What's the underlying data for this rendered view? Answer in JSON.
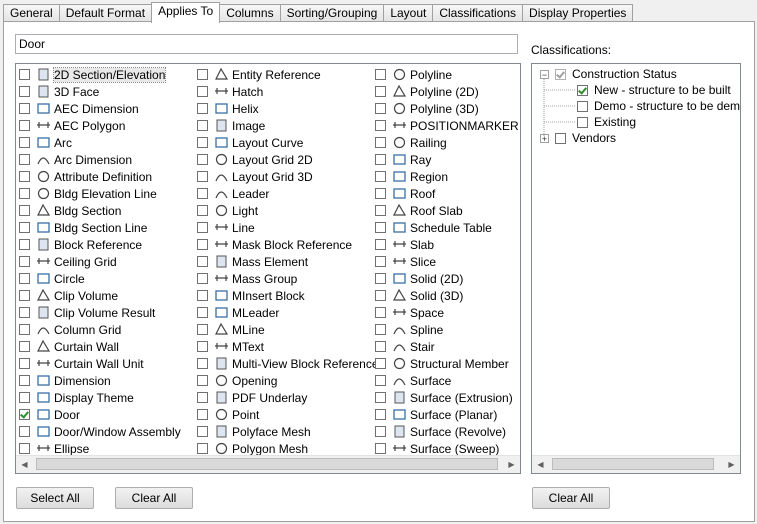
{
  "tabs": [
    "General",
    "Default Format",
    "Applies To",
    "Columns",
    "Sorting/Grouping",
    "Layout",
    "Classifications",
    "Display Properties"
  ],
  "active_tab": "Applies To",
  "filter_value": "Door",
  "col1": [
    {
      "label": "2D Section/Elevation",
      "icon": "section-elevation-icon",
      "checked": false,
      "focused": true
    },
    {
      "label": "3D Face",
      "icon": "3d-face-icon",
      "checked": false
    },
    {
      "label": "AEC Dimension",
      "icon": "aec-dimension-icon",
      "checked": false
    },
    {
      "label": "AEC Polygon",
      "icon": "aec-polygon-icon",
      "checked": false
    },
    {
      "label": "Arc",
      "icon": "arc-icon",
      "checked": false
    },
    {
      "label": "Arc Dimension",
      "icon": "arc-dimension-icon",
      "checked": false
    },
    {
      "label": "Attribute Definition",
      "icon": "attribute-definition-icon",
      "checked": false
    },
    {
      "label": "Bldg Elevation Line",
      "icon": "bldg-elevation-line-icon",
      "checked": false
    },
    {
      "label": "Bldg Section",
      "icon": "bldg-section-icon",
      "checked": false
    },
    {
      "label": "Bldg Section Line",
      "icon": "bldg-section-line-icon",
      "checked": false
    },
    {
      "label": "Block Reference",
      "icon": "block-reference-icon",
      "checked": false
    },
    {
      "label": "Ceiling Grid",
      "icon": "ceiling-grid-icon",
      "checked": false
    },
    {
      "label": "Circle",
      "icon": "circle-icon",
      "checked": false
    },
    {
      "label": "Clip Volume",
      "icon": "clip-volume-icon",
      "checked": false
    },
    {
      "label": "Clip Volume Result",
      "icon": "clip-volume-result-icon",
      "checked": false
    },
    {
      "label": "Column Grid",
      "icon": "column-grid-icon",
      "checked": false
    },
    {
      "label": "Curtain Wall",
      "icon": "curtain-wall-icon",
      "checked": false
    },
    {
      "label": "Curtain Wall Unit",
      "icon": "curtain-wall-unit-icon",
      "checked": false
    },
    {
      "label": "Dimension",
      "icon": "dimension-icon",
      "checked": false
    },
    {
      "label": "Display Theme",
      "icon": "display-theme-icon",
      "checked": false
    },
    {
      "label": "Door",
      "icon": "door-icon",
      "checked": true
    },
    {
      "label": "Door/Window Assembly",
      "icon": "door-window-assembly-icon",
      "checked": false
    },
    {
      "label": "Ellipse",
      "icon": "ellipse-icon",
      "checked": false
    }
  ],
  "col2": [
    {
      "label": "Entity Reference",
      "icon": "entity-reference-icon",
      "checked": false
    },
    {
      "label": "Hatch",
      "icon": "hatch-icon",
      "checked": false
    },
    {
      "label": "Helix",
      "icon": "helix-icon",
      "checked": false
    },
    {
      "label": "Image",
      "icon": "image-icon",
      "checked": false
    },
    {
      "label": "Layout Curve",
      "icon": "layout-curve-icon",
      "checked": false
    },
    {
      "label": "Layout Grid 2D",
      "icon": "layout-grid-2d-icon",
      "checked": false
    },
    {
      "label": "Layout Grid 3D",
      "icon": "layout-grid-3d-icon",
      "checked": false
    },
    {
      "label": "Leader",
      "icon": "leader-icon",
      "checked": false
    },
    {
      "label": "Light",
      "icon": "light-icon",
      "checked": false
    },
    {
      "label": "Line",
      "icon": "line-icon",
      "checked": false
    },
    {
      "label": "Mask Block Reference",
      "icon": "mask-block-icon",
      "checked": false
    },
    {
      "label": "Mass Element",
      "icon": "mass-element-icon",
      "checked": false
    },
    {
      "label": "Mass Group",
      "icon": "mass-group-icon",
      "checked": false
    },
    {
      "label": "MInsert Block",
      "icon": "minsert-block-icon",
      "checked": false
    },
    {
      "label": "MLeader",
      "icon": "mleader-icon",
      "checked": false
    },
    {
      "label": "MLine",
      "icon": "mline-icon",
      "checked": false
    },
    {
      "label": "MText",
      "icon": "mtext-icon",
      "checked": false
    },
    {
      "label": "Multi-View Block Reference",
      "icon": "multi-view-block-icon",
      "checked": false
    },
    {
      "label": "Opening",
      "icon": "opening-icon",
      "checked": false
    },
    {
      "label": "PDF Underlay",
      "icon": "pdf-underlay-icon",
      "checked": false
    },
    {
      "label": "Point",
      "icon": "point-icon",
      "checked": false
    },
    {
      "label": "Polyface Mesh",
      "icon": "polyface-mesh-icon",
      "checked": false
    },
    {
      "label": "Polygon Mesh",
      "icon": "polygon-mesh-icon",
      "checked": false
    }
  ],
  "col3": [
    {
      "label": "Polyline",
      "icon": "polyline-icon",
      "checked": false
    },
    {
      "label": "Polyline (2D)",
      "icon": "polyline-2d-icon",
      "checked": false
    },
    {
      "label": "Polyline (3D)",
      "icon": "polyline-3d-icon",
      "checked": false
    },
    {
      "label": "POSITIONMARKER",
      "icon": "position-marker-icon",
      "checked": false
    },
    {
      "label": "Railing",
      "icon": "railing-icon",
      "checked": false
    },
    {
      "label": "Ray",
      "icon": "ray-icon",
      "checked": false
    },
    {
      "label": "Region",
      "icon": "region-icon",
      "checked": false
    },
    {
      "label": "Roof",
      "icon": "roof-icon",
      "checked": false
    },
    {
      "label": "Roof Slab",
      "icon": "roof-slab-icon",
      "checked": false
    },
    {
      "label": "Schedule Table",
      "icon": "schedule-table-icon",
      "checked": false
    },
    {
      "label": "Slab",
      "icon": "slab-icon",
      "checked": false
    },
    {
      "label": "Slice",
      "icon": "slice-icon",
      "checked": false
    },
    {
      "label": "Solid (2D)",
      "icon": "solid-2d-icon",
      "checked": false
    },
    {
      "label": "Solid (3D)",
      "icon": "solid-3d-icon",
      "checked": false
    },
    {
      "label": "Space",
      "icon": "space-icon",
      "checked": false
    },
    {
      "label": "Spline",
      "icon": "spline-icon",
      "checked": false
    },
    {
      "label": "Stair",
      "icon": "stair-icon",
      "checked": false
    },
    {
      "label": "Structural Member",
      "icon": "structural-member-icon",
      "checked": false
    },
    {
      "label": "Surface",
      "icon": "surface-icon",
      "checked": false
    },
    {
      "label": "Surface (Extrusion)",
      "icon": "surface-extrusion-icon",
      "checked": false
    },
    {
      "label": "Surface (Planar)",
      "icon": "surface-planar-icon",
      "checked": false
    },
    {
      "label": "Surface (Revolve)",
      "icon": "surface-revolve-icon",
      "checked": false
    },
    {
      "label": "Surface (Sweep)",
      "icon": "surface-sweep-icon",
      "checked": false
    }
  ],
  "buttons": {
    "select_all": "Select All",
    "clear_all": "Clear All",
    "clear_all_cls": "Clear All"
  },
  "classifications": {
    "label": "Classifications:",
    "root": "Construction Status",
    "children": [
      "New - structure to be built",
      "Demo - structure to be demolis",
      "Existing"
    ],
    "children_checked": [
      true,
      false,
      false
    ],
    "other_root": "Vendors"
  },
  "colors": {
    "check": "#2a8d2a",
    "icon_blue": "#3a6ea5"
  }
}
